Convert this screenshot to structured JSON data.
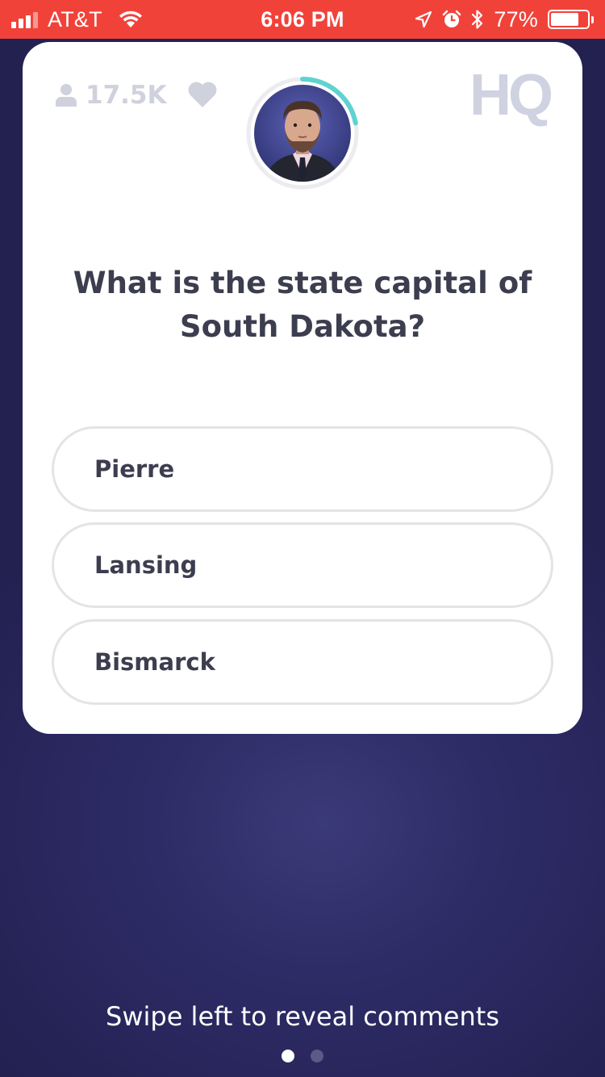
{
  "status_bar": {
    "carrier": "AT&T",
    "time": "6:06 PM",
    "battery_percent": "77%",
    "battery_level": 0.77,
    "icons": [
      "signal-icon",
      "wifi-icon",
      "location-icon",
      "alarm-icon",
      "bluetooth-icon",
      "battery-icon"
    ]
  },
  "game": {
    "logo": "HQ",
    "viewer_count": "17.5K",
    "timer_progress": 0.22,
    "question": "What is the state capital of South Dakota?",
    "answers": [
      "Pierre",
      "Lansing",
      "Bismarck"
    ]
  },
  "footer": {
    "hint": "Swipe left to reveal comments",
    "page_count": 2,
    "active_page": 1
  },
  "colors": {
    "status_bar": "#f1423a",
    "background": "#27255a",
    "timer_ring": "#5fd3d0",
    "text_dark": "#3c3e4f",
    "muted": "#cfd1dc"
  }
}
